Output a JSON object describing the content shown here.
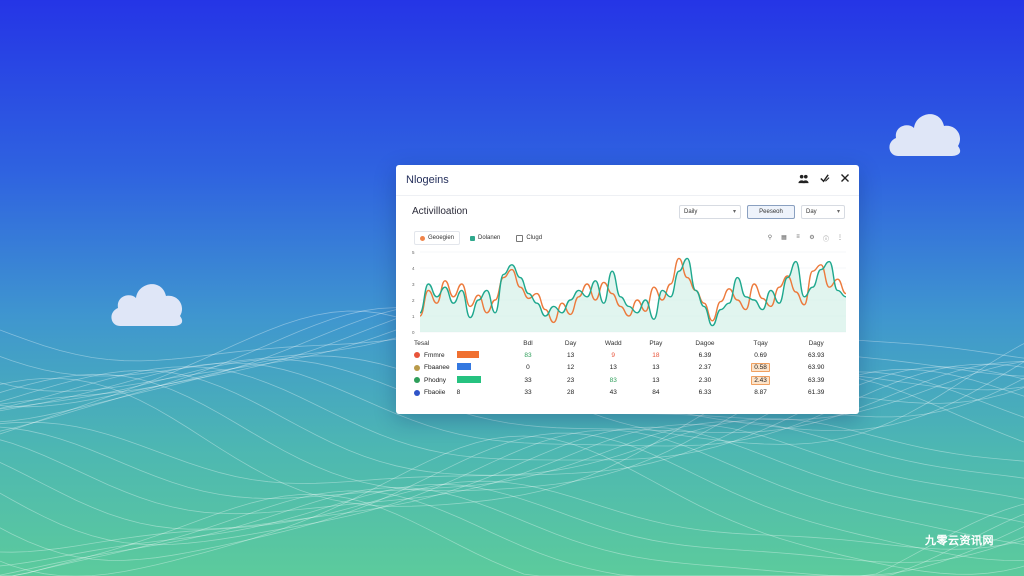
{
  "window": {
    "title": "Nlogeins",
    "icons": [
      "people-icon",
      "check-shield-icon",
      "close-icon"
    ]
  },
  "section": {
    "title": "Activilloation"
  },
  "controls": {
    "dropdown_label": "Daily",
    "primary_button_label": "Peeseoh",
    "secondary_select_label": "Day"
  },
  "legend": {
    "items": [
      {
        "label": "Geoegien",
        "color": "#f0844a"
      },
      {
        "label": "Dolanen",
        "color": "#2fa88c"
      },
      {
        "label": "Clugd",
        "color": "#777777"
      }
    ]
  },
  "chart_icons": [
    "filter-icon",
    "grid-icon",
    "list-icon",
    "settings-icon",
    "info-icon",
    "more-icon"
  ],
  "chart_data": {
    "type": "line",
    "y_ticks": [
      "5",
      "4",
      "3",
      "2",
      "1",
      "0"
    ],
    "ylim": [
      0,
      5
    ],
    "x": [
      0,
      1,
      2,
      3,
      4,
      5,
      6,
      7,
      8,
      9,
      10,
      11,
      12,
      13,
      14,
      15,
      16,
      17,
      18,
      19,
      20,
      21,
      22,
      23,
      24,
      25,
      26,
      27,
      28,
      29,
      30,
      31,
      32,
      33,
      34,
      35,
      36,
      37,
      38,
      39,
      40,
      41,
      42,
      43,
      44,
      45,
      46,
      47,
      48,
      49,
      50,
      51,
      52,
      53,
      54,
      55,
      56,
      57,
      58,
      59
    ],
    "series": [
      {
        "color": "#ec7a3c",
        "values": [
          1.0,
          2.6,
          1.8,
          3.2,
          2.2,
          3.0,
          1.6,
          2.3,
          1.2,
          2.0,
          3.4,
          3.9,
          2.8,
          2.1,
          2.4,
          1.4,
          0.6,
          1.8,
          1.1,
          2.2,
          3.0,
          2.0,
          3.1,
          2.4,
          1.6,
          1.0,
          2.0,
          1.3,
          2.8,
          2.0,
          3.0,
          4.6,
          3.4,
          2.6,
          1.8,
          0.7,
          1.9,
          2.7,
          2.0,
          1.4,
          3.0,
          2.1,
          1.6,
          2.8,
          3.5,
          2.5,
          1.7,
          3.8,
          4.2,
          2.8,
          3.3,
          2.4
        ]
      },
      {
        "color": "#1fa88e",
        "values": [
          1.2,
          3.0,
          2.2,
          2.8,
          1.8,
          2.6,
          0.9,
          2.0,
          2.6,
          1.2,
          3.6,
          4.2,
          3.4,
          2.4,
          1.8,
          1.0,
          1.6,
          1.2,
          2.0,
          2.6,
          2.2,
          3.2,
          1.8,
          3.8,
          2.2,
          1.6,
          1.2,
          2.0,
          0.8,
          2.6,
          2.2,
          3.8,
          4.6,
          2.6,
          1.6,
          0.4,
          1.4,
          1.8,
          3.4,
          2.2,
          2.0,
          1.4,
          2.6,
          1.8,
          3.4,
          4.4,
          2.2,
          2.8,
          3.9,
          4.4,
          2.6,
          2.2
        ]
      }
    ]
  },
  "table": {
    "headers": [
      "Tesal",
      "",
      "Bdl",
      "Day",
      "Wadd",
      "Ptay",
      "Dagoe",
      "Tqay",
      "Dagy"
    ],
    "rows": [
      {
        "name": "Fmmre",
        "dot_color": "#e8543a",
        "bar_color": "#f07030",
        "bar_fill": 0.95,
        "bar_text": "",
        "values": [
          "83",
          "13",
          "9",
          "18",
          "6.39",
          "0.69",
          "63.93"
        ],
        "colors": [
          "#2e9e5a",
          "#222222",
          "#e8543a",
          "#e8543a",
          "#222222",
          "#222222",
          "#222222"
        ],
        "highlight": ""
      },
      {
        "name": "Fbaanee",
        "dot_color": "#b99a4a",
        "bar_color": "#3478e0",
        "bar_fill": 0.58,
        "bar_text": "",
        "values": [
          "0",
          "12",
          "13",
          "13",
          "2.37",
          "0.58",
          "63.90"
        ],
        "colors": [
          "#222222",
          "#222222",
          "#222222",
          "#222222",
          "#222222",
          "#222222",
          "#222222"
        ],
        "highlight": "0.58"
      },
      {
        "name": "Phodny",
        "dot_color": "#2e9e5a",
        "bar_color": "#26c280",
        "bar_fill": 1.0,
        "bar_text": "",
        "values": [
          "33",
          "23",
          "83",
          "13",
          "2.30",
          "2.43",
          "63.39"
        ],
        "colors": [
          "#222222",
          "#222222",
          "#2e9e5a",
          "#222222",
          "#222222",
          "#222222",
          "#222222"
        ],
        "highlight": "2.43"
      },
      {
        "name": "Fbaoiie",
        "dot_color": "#2f54c8",
        "bar_color": "",
        "bar_fill": 0,
        "bar_text": "8",
        "values": [
          "33",
          "28",
          "43",
          "84",
          "6.33",
          "8.87",
          "61.39"
        ],
        "colors": [
          "#222222",
          "#222222",
          "#222222",
          "#222222",
          "#222222",
          "#222222",
          "#222222"
        ],
        "highlight": ""
      }
    ]
  },
  "watermark": "九零云资讯网"
}
